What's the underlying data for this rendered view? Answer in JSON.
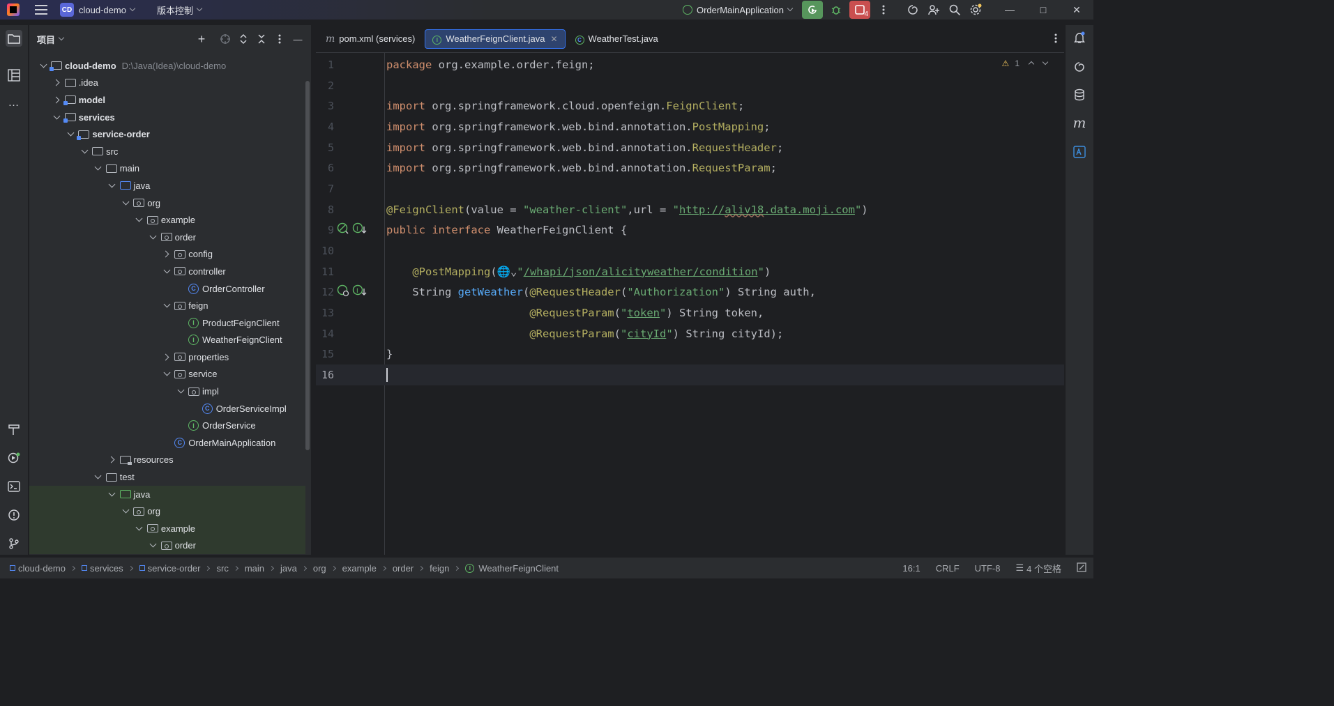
{
  "titlebar": {
    "project_badge": "CD",
    "project_name": "cloud-demo",
    "vcs_menu": "版本控制",
    "run_config": "OrderMainApplication",
    "stop_badge_count": "4"
  },
  "project_panel": {
    "title": "项目",
    "tree": [
      {
        "label": "cloud-demo",
        "path": "D:\\Java(Idea)\\cloud-demo",
        "depth": 0,
        "arrow": "open",
        "icon": "module-folder",
        "bold": true
      },
      {
        "label": ".idea",
        "depth": 1,
        "arrow": "closed",
        "icon": "folder"
      },
      {
        "label": "model",
        "depth": 1,
        "arrow": "closed",
        "icon": "module-folder",
        "bold": true
      },
      {
        "label": "services",
        "depth": 1,
        "arrow": "open",
        "icon": "module-folder",
        "bold": true
      },
      {
        "label": "service-order",
        "depth": 2,
        "arrow": "open",
        "icon": "module-folder",
        "bold": true
      },
      {
        "label": "src",
        "depth": 3,
        "arrow": "open",
        "icon": "folder"
      },
      {
        "label": "main",
        "depth": 4,
        "arrow": "open",
        "icon": "folder"
      },
      {
        "label": "java",
        "depth": 5,
        "arrow": "open",
        "icon": "source-folder"
      },
      {
        "label": "org",
        "depth": 6,
        "arrow": "open",
        "icon": "package"
      },
      {
        "label": "example",
        "depth": 7,
        "arrow": "open",
        "icon": "package"
      },
      {
        "label": "order",
        "depth": 8,
        "arrow": "open",
        "icon": "package"
      },
      {
        "label": "config",
        "depth": 9,
        "arrow": "closed",
        "icon": "package"
      },
      {
        "label": "controller",
        "depth": 9,
        "arrow": "open",
        "icon": "package"
      },
      {
        "label": "OrderController",
        "depth": 10,
        "arrow": "none",
        "icon": "class"
      },
      {
        "label": "feign",
        "depth": 9,
        "arrow": "open",
        "icon": "package"
      },
      {
        "label": "ProductFeignClient",
        "depth": 10,
        "arrow": "none",
        "icon": "interface"
      },
      {
        "label": "WeatherFeignClient",
        "depth": 10,
        "arrow": "none",
        "icon": "interface"
      },
      {
        "label": "properties",
        "depth": 9,
        "arrow": "closed",
        "icon": "package"
      },
      {
        "label": "service",
        "depth": 9,
        "arrow": "open",
        "icon": "package"
      },
      {
        "label": "impl",
        "depth": 10,
        "arrow": "open",
        "icon": "package"
      },
      {
        "label": "OrderServiceImpl",
        "depth": 11,
        "arrow": "none",
        "icon": "class"
      },
      {
        "label": "OrderService",
        "depth": 10,
        "arrow": "none",
        "icon": "interface"
      },
      {
        "label": "OrderMainApplication",
        "depth": 9,
        "arrow": "none",
        "icon": "spring-class"
      },
      {
        "label": "resources",
        "depth": 5,
        "arrow": "closed",
        "icon": "resources-folder"
      },
      {
        "label": "test",
        "depth": 4,
        "arrow": "open",
        "icon": "folder"
      },
      {
        "label": "java",
        "depth": 5,
        "arrow": "open",
        "icon": "test-folder",
        "highlight": true
      },
      {
        "label": "org",
        "depth": 6,
        "arrow": "open",
        "icon": "package",
        "highlight": true
      },
      {
        "label": "example",
        "depth": 7,
        "arrow": "open",
        "icon": "package",
        "highlight": true
      },
      {
        "label": "order",
        "depth": 8,
        "arrow": "open",
        "icon": "package",
        "highlight": true
      }
    ]
  },
  "editor": {
    "tabs": [
      {
        "label": "pom.xml (services)",
        "icon": "maven-icon",
        "active": false
      },
      {
        "label": "WeatherFeignClient.java",
        "icon": "interface-icon",
        "active": true
      },
      {
        "label": "WeatherTest.java",
        "icon": "test-class-icon",
        "active": false
      }
    ],
    "warning_count": "1",
    "lines": [
      {
        "n": "1",
        "html": "<span class='k'>package</span> org.example.order.feign;"
      },
      {
        "n": "2",
        "html": ""
      },
      {
        "n": "3",
        "html": "<span class='k'>import</span> org.springframework.cloud.openfeign.<span class='a'>FeignClient</span>;"
      },
      {
        "n": "4",
        "html": "<span class='k'>import</span> org.springframework.web.bind.annotation.<span class='a'>PostMapping</span>;"
      },
      {
        "n": "5",
        "html": "<span class='k'>import</span> org.springframework.web.bind.annotation.<span class='a'>RequestHeader</span>;"
      },
      {
        "n": "6",
        "html": "<span class='k'>import</span> org.springframework.web.bind.annotation.<span class='a'>RequestParam</span>;"
      },
      {
        "n": "7",
        "html": ""
      },
      {
        "n": "8",
        "html": "<span class='a'>@FeignClient</span>(value = <span class='s'>\"weather-client\"</span>,url = <span class='s'>\"<span class='u'>http://<span class='wavy'>aliv18</span>.data.moji.com</span>\"</span>)"
      },
      {
        "n": "9",
        "html": "<span class='k'>public interface</span> WeatherFeignClient {",
        "gutter": [
          "bean-icon",
          "implemented-icon"
        ]
      },
      {
        "n": "10",
        "html": ""
      },
      {
        "n": "11",
        "html": "    <span class='a'>@PostMapping</span>(<span class='t'>&#x1F310;&#x2304;</span><span class='s'>\"<span class='u'>/whapi/json/alicityweather/condition</span>\"</span>)"
      },
      {
        "n": "12",
        "html": "    String <span class='m'>getWeather</span>(<span class='a'>@RequestHeader</span>(<span class='s'>\"Authorization\"</span>) String auth,",
        "gutter": [
          "endpoint-icon",
          "implemented-icon"
        ]
      },
      {
        "n": "13",
        "html": "                      <span class='a'>@RequestParam</span>(<span class='s'>\"<span class='u'>token</span>\"</span>) String token,"
      },
      {
        "n": "14",
        "html": "                      <span class='a'>@RequestParam</span>(<span class='s'>\"<span class='u'>cityId</span>\"</span>) String cityId);"
      },
      {
        "n": "15",
        "html": "}"
      },
      {
        "n": "16",
        "html": "",
        "current": true
      }
    ]
  },
  "statusbar": {
    "breadcrumbs": [
      "cloud-demo",
      "services",
      "service-order",
      "src",
      "main",
      "java",
      "org",
      "example",
      "order",
      "feign",
      "WeatherFeignClient"
    ],
    "position": "16:1",
    "line_sep": "CRLF",
    "encoding": "UTF-8",
    "indent": "4 个空格"
  }
}
